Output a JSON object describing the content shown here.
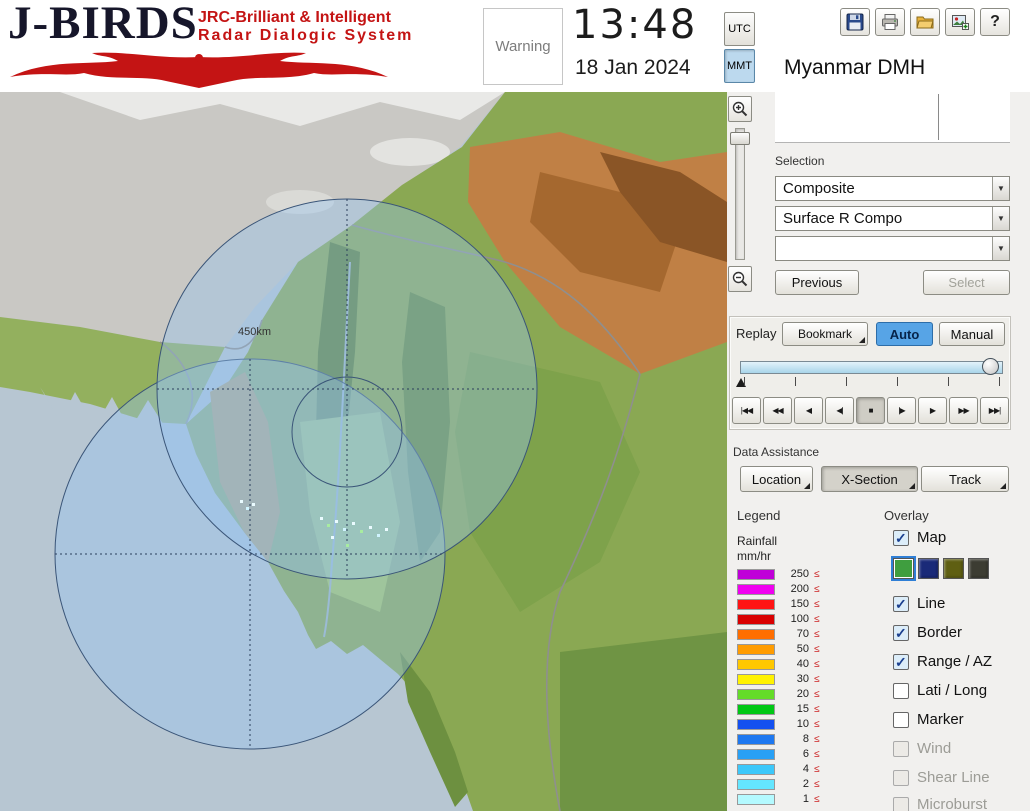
{
  "icons": {
    "check": "✓",
    "dropdown_arrow": "▼",
    "help": "?",
    "lte": "≤"
  },
  "header": {
    "logo": {
      "title": "J-BIRDS",
      "subtitle_line1": "JRC-Brilliant & Intelligent",
      "subtitle_line2": "Radar  Dialogic  System"
    },
    "warning_label": "Warning",
    "clock": {
      "time": "13:48",
      "date": "18 Jan 2024"
    },
    "timezone": {
      "utc_label": "UTC",
      "mmt_label": "MMT",
      "selected": "MMT"
    },
    "org_name": "Myanmar DMH"
  },
  "selection": {
    "label": "Selection",
    "dropdown1_value": "Composite",
    "dropdown2_value": "Surface R Compo",
    "dropdown3_value": "",
    "previous_label": "Previous",
    "select_label": "Select"
  },
  "replay": {
    "label": "Replay",
    "bookmark_label": "Bookmark",
    "auto_label": "Auto",
    "manual_label": "Manual",
    "selected_mode": "Auto",
    "playback_buttons": [
      "|◀◀",
      "◀◀",
      "◀",
      "◀|",
      "■",
      "|▶",
      "▶",
      "▶▶",
      "▶▶|"
    ],
    "active_playback_index": 4
  },
  "data_assistance": {
    "label": "Data Assistance",
    "location_label": "Location",
    "xsection_label": "X-Section",
    "track_label": "Track"
  },
  "legend": {
    "label": "Legend",
    "title": "Rainfall",
    "unit": "mm/hr",
    "scale": [
      {
        "value": "250",
        "color": "#bf00d8"
      },
      {
        "value": "200",
        "color": "#f000f0"
      },
      {
        "value": "150",
        "color": "#ff1414"
      },
      {
        "value": "100",
        "color": "#d90000"
      },
      {
        "value": "70",
        "color": "#ff6e00"
      },
      {
        "value": "50",
        "color": "#ff9c00"
      },
      {
        "value": "40",
        "color": "#ffc800"
      },
      {
        "value": "30",
        "color": "#fff200"
      },
      {
        "value": "20",
        "color": "#64dc28"
      },
      {
        "value": "15",
        "color": "#00c814"
      },
      {
        "value": "10",
        "color": "#1450f0"
      },
      {
        "value": "8",
        "color": "#1e78f0"
      },
      {
        "value": "6",
        "color": "#28a0f5"
      },
      {
        "value": "4",
        "color": "#3cc8fa"
      },
      {
        "value": "2",
        "color": "#64e6ff"
      },
      {
        "value": "1",
        "color": "#b4faff"
      }
    ]
  },
  "overlay": {
    "label": "Overlay",
    "items": [
      {
        "label": "Map",
        "checked": true,
        "enabled": true
      },
      {
        "label": "Line",
        "checked": true,
        "enabled": true
      },
      {
        "label": "Border",
        "checked": true,
        "enabled": true
      },
      {
        "label": "Range / AZ",
        "checked": true,
        "enabled": true
      },
      {
        "label": "Lati / Long",
        "checked": false,
        "enabled": true
      },
      {
        "label": "Marker",
        "checked": false,
        "enabled": true
      },
      {
        "label": "Wind",
        "checked": false,
        "enabled": false
      },
      {
        "label": "Shear Line",
        "checked": false,
        "enabled": false
      },
      {
        "label": "Microburst",
        "checked": false,
        "enabled": false
      }
    ],
    "map_styles": [
      {
        "color": "#3f9e3f",
        "selected": true
      },
      {
        "color": "#1a2a78",
        "selected": false
      },
      {
        "color": "#5f5f12",
        "selected": false
      },
      {
        "color": "#3c3c32",
        "selected": false
      }
    ]
  },
  "map": {
    "range_label": "450km"
  }
}
